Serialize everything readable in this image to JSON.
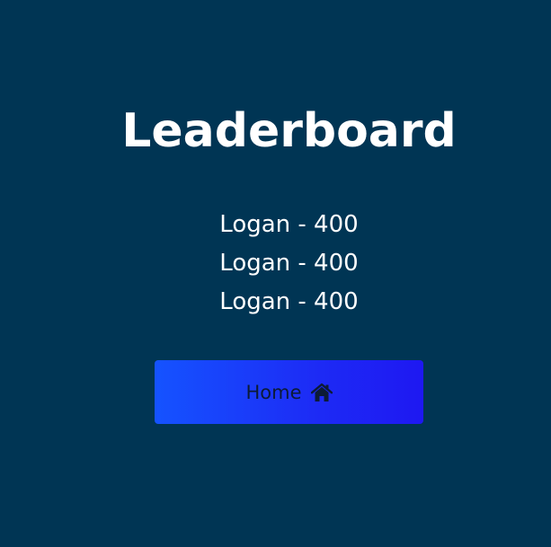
{
  "leaderboard": {
    "title": "Leaderboard",
    "scores": [
      "Logan - 400",
      "Logan - 400",
      "Logan - 400"
    ]
  },
  "home_button": {
    "label": "Home",
    "icon": "home-icon"
  },
  "colors": {
    "background": "#003554",
    "button_gradient_start": "#1553ff",
    "button_gradient_end": "#1e18f2",
    "text": "#ffffff",
    "button_text": "#0c1b37"
  }
}
